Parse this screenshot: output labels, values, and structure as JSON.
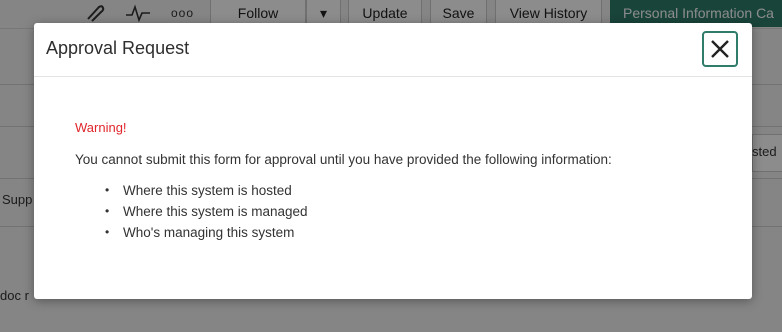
{
  "background": {
    "toolbar": {
      "icons": [
        "paperclip-icon",
        "activity-icon",
        "more-icon"
      ],
      "more_glyph": "ooo",
      "follow_label": "Follow",
      "follow_caret": "▾",
      "update_label": "Update",
      "save_label": "Save",
      "view_history_label": "View History",
      "personal_info_label": "Personal Information Ca"
    },
    "fragments": {
      "left_supp": "Supp",
      "right_sted": "sted",
      "left_doc": "doc r"
    }
  },
  "modal": {
    "title": "Approval Request",
    "close_glyph": "✕",
    "warning": "Warning!",
    "message": "You cannot submit this form for approval until you have provided the following information:",
    "items": [
      "Where this system is hosted",
      "Where this system is managed",
      "Who's managing this system"
    ],
    "bullet": "•"
  },
  "colors": {
    "accent": "#2f7c6b",
    "warning": "#e0262b",
    "overlay": "rgba(0,0,0,0.45)"
  }
}
